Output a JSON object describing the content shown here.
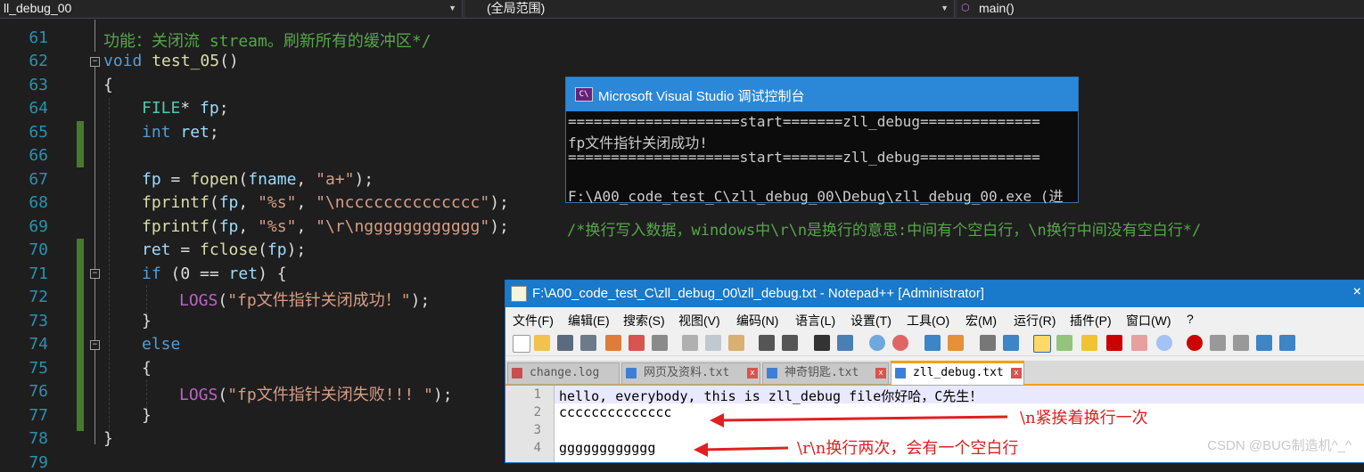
{
  "toolbar": {
    "file_dropdown": "ll_debug_00",
    "scope_dropdown": "(全局范围)",
    "function_dropdown": "main()"
  },
  "editor": {
    "lines": [
      {
        "num": "61",
        "text": "功能：关闭流 stream。刷新所有的缓冲区*/"
      },
      {
        "num": "62",
        "text": "void test_05()"
      },
      {
        "num": "63",
        "text": "{"
      },
      {
        "num": "64",
        "text": "FILE* fp;"
      },
      {
        "num": "65",
        "text": "int ret;"
      },
      {
        "num": "66",
        "text": ""
      },
      {
        "num": "67",
        "text": "fp = fopen(fname, \"a+\");"
      },
      {
        "num": "68",
        "text": "fprintf(fp, \"%s\", \"\\ncccccccccccccc\");"
      },
      {
        "num": "69",
        "text": "fprintf(fp, \"%s\", \"\\r\\ngggggggggggg\");"
      },
      {
        "num": "70",
        "text": "ret = fclose(fp);"
      },
      {
        "num": "71",
        "text": "if (0 == ret) {"
      },
      {
        "num": "72",
        "text": "LOGS(\"fp文件指针关闭成功！\");"
      },
      {
        "num": "73",
        "text": "}"
      },
      {
        "num": "74",
        "text": "else"
      },
      {
        "num": "75",
        "text": "{"
      },
      {
        "num": "76",
        "text": "LOGS(\"fp文件指针关闭失败!!! \");"
      },
      {
        "num": "77",
        "text": "}"
      },
      {
        "num": "78",
        "text": "}"
      },
      {
        "num": "79",
        "text": ""
      }
    ],
    "comment_right": "/*换行写入数据，windows中\\r\\n是换行的意思:中间有个空白行，\\n换行中间没有空白行*/"
  },
  "console": {
    "title": "Microsoft Visual Studio 调试控制台",
    "lines": [
      "====================start=======zll_debug==============",
      "fp文件指针关闭成功!",
      "====================start=======zll_debug==============",
      "",
      "F:\\A00_code_test_C\\zll_debug_00\\Debug\\zll_debug_00.exe (进"
    ]
  },
  "notepad": {
    "title": "F:\\A00_code_test_C\\zll_debug_00\\zll_debug.txt - Notepad++ [Administrator]",
    "close": "×",
    "menu": [
      "文件(F)",
      "编辑(E)",
      "搜索(S)",
      "视图(V)",
      "编码(N)",
      "语言(L)",
      "设置(T)",
      "工具(O)",
      "宏(M)",
      "运行(R)",
      "插件(P)",
      "窗口(W)",
      "?"
    ],
    "tabs": [
      "change.log",
      "网页及资料.txt",
      "神奇钥匙.txt",
      "zll_debug.txt"
    ],
    "lines": [
      {
        "num": "1",
        "text": "hello, everybody, this is zll_debug file你好哈，C先生！"
      },
      {
        "num": "2",
        "text": "cccccccccccccc"
      },
      {
        "num": "3",
        "text": ""
      },
      {
        "num": "4",
        "text": "gggggggggggg"
      }
    ]
  },
  "annotations": {
    "note1": "\\n紧挨着换行一次",
    "note2": "\\r\\n换行两次，会有一个空白行"
  },
  "watermark": "CSDN @BUG制造机^_^"
}
